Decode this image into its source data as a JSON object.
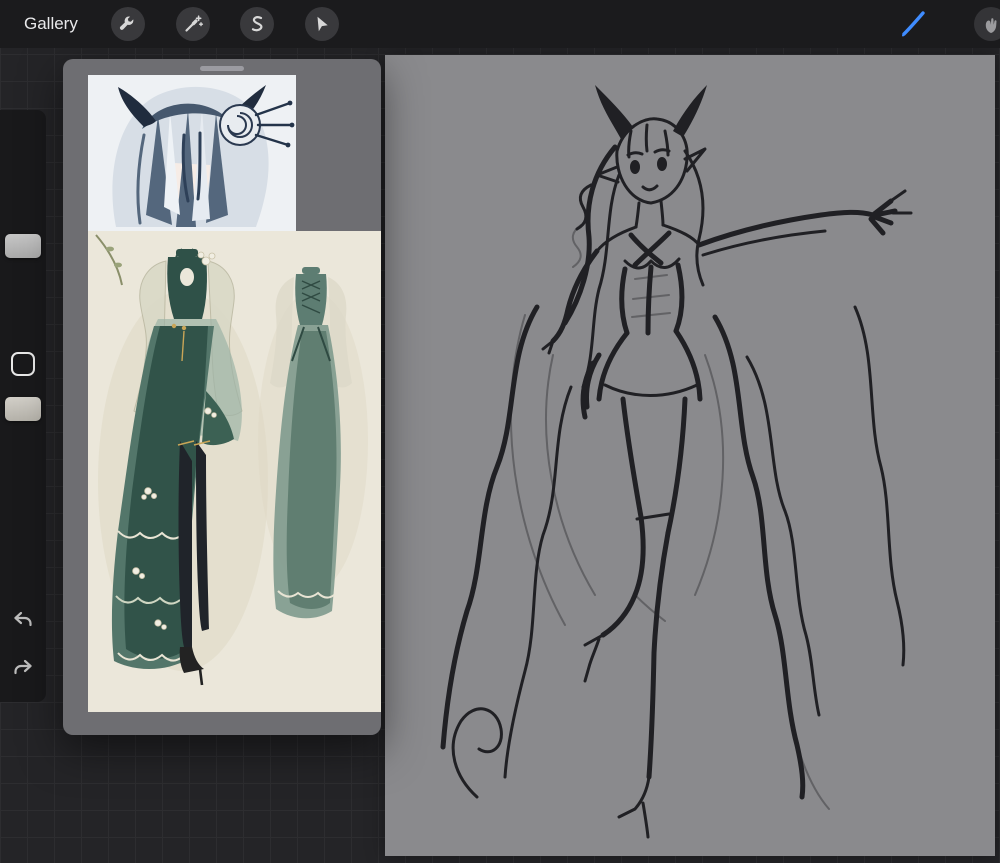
{
  "toolbar": {
    "gallery_label": "Gallery",
    "left_tools": [
      {
        "id": "actions",
        "icon": "wrench-icon"
      },
      {
        "id": "adjustments",
        "icon": "magic-wand-icon"
      },
      {
        "id": "selection",
        "icon": "selection-s-icon"
      },
      {
        "id": "transform",
        "icon": "cursor-arrow-icon"
      }
    ],
    "right_tools": [
      {
        "id": "paint",
        "icon": "paintbrush-icon",
        "active": true
      },
      {
        "id": "smudge",
        "icon": "smudge-finger-icon",
        "active": false
      }
    ],
    "accent_color": "#3f8cff"
  },
  "sidebar": {
    "controls": [
      "brush-size-slider",
      "modify-button",
      "opacity-slider",
      "undo-button",
      "redo-button"
    ]
  },
  "reference_panel": {
    "images": [
      "character-head-reference",
      "outfit-design-reference"
    ]
  },
  "canvas": {
    "content": "figure-sketch",
    "background": "#8a8a8d"
  },
  "colors": {
    "topbar": "#1b1b1d",
    "workspace": "#242427",
    "grid_line": "#2d2d30",
    "panel": "#6e6e72",
    "sketch_ink": "#202024"
  }
}
